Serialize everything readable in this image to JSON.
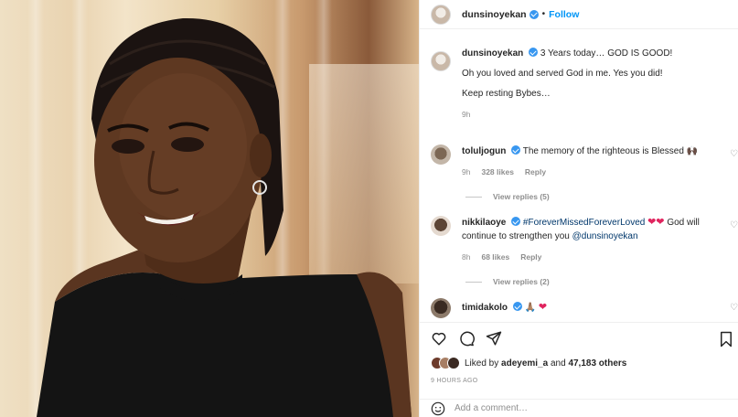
{
  "header": {
    "username": "dunsinoyekan",
    "separator": "•",
    "follow_label": "Follow"
  },
  "caption": {
    "username": "dunsinoyekan",
    "line1": "3 Years today… GOD IS GOOD!",
    "line2": "Oh you loved and served God in me. Yes you did!",
    "line3": "Keep resting Bybes…",
    "time": "9h"
  },
  "comments": [
    {
      "username": "toluljogun",
      "text": "The memory of the righteous is Blessed",
      "emoji": "🙌🏿",
      "time": "9h",
      "likes": "328 likes",
      "reply": "Reply",
      "view_replies": "View replies (5)"
    },
    {
      "username": "nikkilaoye",
      "text_a": "#ForeverMissedForeverLoved",
      "hearts": "❤❤",
      "text_b": "God will continue to strengthen you",
      "mention": "@dunsinoyekan",
      "time": "8h",
      "likes": "68 likes",
      "reply": "Reply",
      "view_replies": "View replies (2)"
    },
    {
      "username": "timidakolo",
      "emoji": "🙏🏽",
      "heart": "❤"
    }
  ],
  "likes": {
    "prefix": "Liked by",
    "user": "adeyemi_a",
    "middle": "and",
    "count": "47,183 others"
  },
  "timestamp": "9 HOURS AGO",
  "add_comment_placeholder": "Add a comment…",
  "colors": {
    "link_blue": "#0095f6",
    "verified": "#3897f0",
    "heart_red": "#e0245e",
    "muted": "#8e8e8e"
  }
}
